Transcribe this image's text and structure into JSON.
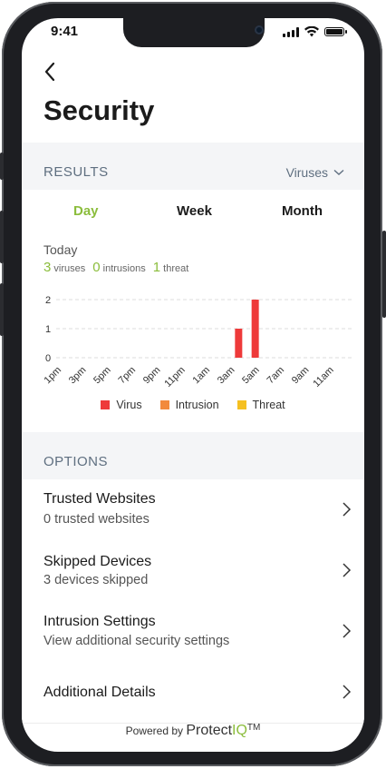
{
  "status_bar": {
    "time": "9:41"
  },
  "header": {
    "title": "Security"
  },
  "results": {
    "label": "RESULTS",
    "filter": "Viruses",
    "tabs": [
      {
        "label": "Day",
        "active": true
      },
      {
        "label": "Week",
        "active": false
      },
      {
        "label": "Month",
        "active": false
      }
    ],
    "period": "Today",
    "stats": {
      "viruses_count": "3",
      "viruses_label": "viruses",
      "intrusions_count": "0",
      "intrusions_label": "intrusions",
      "threats_count": "1",
      "threats_label": "threat"
    }
  },
  "chart_data": {
    "type": "bar",
    "categories": [
      "1pm",
      "3pm",
      "5pm",
      "7pm",
      "9pm",
      "11pm",
      "1am",
      "3am",
      "5am",
      "7am",
      "9am",
      "11am"
    ],
    "y_ticks": [
      "2",
      "1",
      "0"
    ],
    "ylim": [
      0,
      2
    ],
    "series": [
      {
        "name": "Virus",
        "color": "#ee3a3a",
        "values": [
          0,
          0,
          0,
          0,
          0,
          0,
          0,
          1,
          2,
          0,
          0,
          0
        ]
      },
      {
        "name": "Intrusion",
        "color": "#f28a3c",
        "values": [
          0,
          0,
          0,
          0,
          0,
          0,
          0,
          0,
          0,
          0,
          0,
          0
        ]
      },
      {
        "name": "Threat",
        "color": "#f5c021",
        "values": [
          0,
          0,
          0,
          0,
          0,
          0,
          0,
          0,
          0,
          0,
          0,
          0
        ]
      }
    ],
    "legend_position": "bottom"
  },
  "options": {
    "label": "OPTIONS",
    "items": [
      {
        "title": "Trusted Websites",
        "subtitle": "0 trusted websites"
      },
      {
        "title": "Skipped Devices",
        "subtitle": "3 devices skipped"
      },
      {
        "title": "Intrusion Settings",
        "subtitle": "View additional security settings"
      },
      {
        "title": "Additional Details",
        "subtitle": ""
      }
    ]
  },
  "footer": {
    "powered_by": "Powered by",
    "brand_a": "Protect",
    "brand_b": "IQ",
    "tm": "TM"
  },
  "colors": {
    "accent": "#8bbd3c",
    "section_bg": "#f4f5f7",
    "section_text": "#5f6f80"
  }
}
